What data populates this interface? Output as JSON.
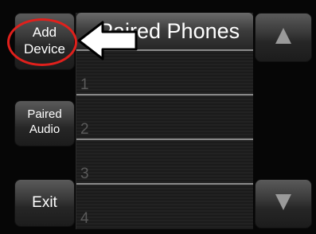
{
  "screen": {
    "title": "Paired Phones",
    "left_buttons": {
      "add_device": "Add\nDevice",
      "paired_audio": "Paired\nAudio",
      "exit": "Exit"
    },
    "slots": [
      "1",
      "2",
      "3",
      "4"
    ],
    "scroll": {
      "up_icon": "triangle-up-icon",
      "down_icon": "triangle-down-icon"
    }
  },
  "annotation": {
    "highlight_color": "#e0201c",
    "arrow_icon": "white-left-arrow-icon"
  }
}
